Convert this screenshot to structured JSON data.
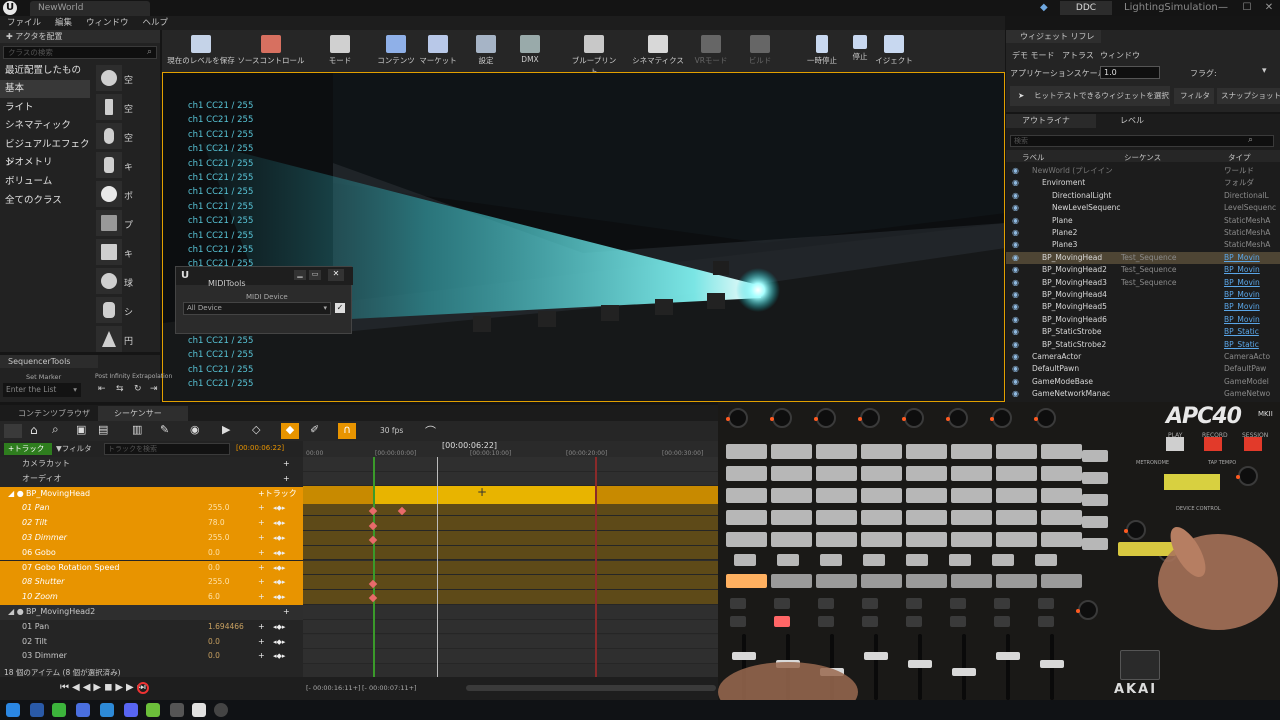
{
  "titlebar": {
    "tab": "NewWorld",
    "ddc": "DDC",
    "project": "LightingSimulation",
    "minimize": "—",
    "maximize": "☐",
    "close": "✕"
  },
  "menu": [
    "ファイル",
    "編集",
    "ウィンドウ",
    "ヘルプ"
  ],
  "place_panel": {
    "header": "アクタを配置",
    "search_placeholder": "クラスの検索",
    "categories": [
      "最近配置したもの",
      "基本",
      "ライト",
      "シネマティック",
      "ビジュアルエフェクト",
      "ジオメトリ",
      "ボリューム",
      "全てのクラス"
    ],
    "actor_labels": [
      "空",
      "空",
      "空",
      "キ",
      "ポ",
      "プ",
      "キ",
      "球",
      "シ",
      "円",
      "平"
    ]
  },
  "toolbar": {
    "buttons": [
      "現在のレベルを保存",
      "ソースコントロール",
      "モード",
      "コンテンツ",
      "マーケット",
      "設定",
      "DMX",
      "ブループリント",
      "シネマティクス",
      "VRモード",
      "ビルド",
      "一時停止",
      "停止",
      "イジェクト"
    ]
  },
  "viewport": {
    "channel_label": "ch1 CC21 / 255",
    "channel_count": 19
  },
  "midi_tools": {
    "title": "MIDITools",
    "device_label": "MIDI Device",
    "device_value": "All Device"
  },
  "sequencer_tools": {
    "title": "SequencerTools",
    "set_marker": "Set Marker",
    "post_infinity": "Post Infinity Extrapolation",
    "list_placeholder": "Enter the List"
  },
  "widget_panel": {
    "tab": "ウィジェット リフレ",
    "menu": [
      "デモ モード",
      "アトラス",
      "ウィンドウ"
    ],
    "app_scale_label": "アプリケーションスケール:",
    "app_scale_value": "1.0",
    "flags_label": "フラグ:",
    "hit_test_label": "ヒットテストできるウィジェットを選択",
    "filter_label": "フィルタ",
    "snapshot_label": "スナップショット"
  },
  "outliner": {
    "tabs": [
      "アウトライナ",
      "レベル"
    ],
    "search_placeholder": "検索",
    "columns": {
      "label": "ラベル",
      "sequence": "シーケンス",
      "type": "タイプ"
    },
    "rows": [
      {
        "name": "NewWorld (プレイイン",
        "seq": "",
        "type": "ワールド",
        "indent": 0,
        "dim": true
      },
      {
        "name": "Enviroment",
        "seq": "",
        "type": "フォルダ",
        "indent": 1
      },
      {
        "name": "DirectionalLight",
        "seq": "",
        "type": "DirectionalL",
        "indent": 2
      },
      {
        "name": "NewLevelSequenc",
        "seq": "",
        "type": "LevelSequenc",
        "indent": 2
      },
      {
        "name": "Plane",
        "seq": "",
        "type": "StaticMeshA",
        "indent": 2
      },
      {
        "name": "Plane2",
        "seq": "",
        "type": "StaticMeshA",
        "indent": 2
      },
      {
        "name": "Plane3",
        "seq": "",
        "type": "StaticMeshA",
        "indent": 2
      },
      {
        "name": "BP_MovingHead",
        "seq": "Test_Sequence",
        "type": "BP_Movin",
        "indent": 1,
        "sel": true,
        "link": true
      },
      {
        "name": "BP_MovingHead2",
        "seq": "Test_Sequence",
        "type": "BP_Movin",
        "indent": 1,
        "link": true
      },
      {
        "name": "BP_MovingHead3",
        "seq": "Test_Sequence",
        "type": "BP_Movin",
        "indent": 1,
        "link": true
      },
      {
        "name": "BP_MovingHead4",
        "seq": "",
        "type": "BP_Movin",
        "indent": 1,
        "link": true
      },
      {
        "name": "BP_MovingHead5",
        "seq": "",
        "type": "BP_Movin",
        "indent": 1,
        "link": true
      },
      {
        "name": "BP_MovingHead6",
        "seq": "",
        "type": "BP_Movin",
        "indent": 1,
        "link": true
      },
      {
        "name": "BP_StaticStrobe",
        "seq": "",
        "type": "BP_Static",
        "indent": 1,
        "link": true
      },
      {
        "name": "BP_StaticStrobe2",
        "seq": "",
        "type": "BP_Static",
        "indent": 1,
        "link": true
      },
      {
        "name": "CameraActor",
        "seq": "",
        "type": "CameraActo",
        "indent": 0
      },
      {
        "name": "DefaultPawn",
        "seq": "",
        "type": "DefaultPaw",
        "indent": 0
      },
      {
        "name": "GameModeBase",
        "seq": "",
        "type": "GameModel",
        "indent": 0
      },
      {
        "name": "GameNetworkManac",
        "seq": "",
        "type": "GameNetwo",
        "indent": 0
      },
      {
        "name": "GameSession",
        "seq": "",
        "type": "GameSessi",
        "indent": 0
      }
    ]
  },
  "sequencer": {
    "tabs": [
      "コンテンツブラウザ",
      "シーケンサー"
    ],
    "fps": "30 fps",
    "current_time": "[00:00:06:22]",
    "track_button": "+トラック",
    "filter_button": "フィルタ",
    "track_search_placeholder": "トラックを検索",
    "time_field": "[00:00:06:22]",
    "ruler": [
      "00:00",
      "[00:00:00:00]",
      "[00:00:10:00]",
      "[00:00:20:00]",
      "[00:00:30:00]"
    ],
    "tracks": [
      {
        "name": "カメラカット",
        "value": "",
        "level": 0,
        "orange": false,
        "italic": false
      },
      {
        "name": "オーディオ",
        "value": "",
        "level": 0,
        "orange": false,
        "italic": false
      },
      {
        "name": "BP_MovingHead",
        "value": "",
        "level": 0,
        "orange": true,
        "italic": false,
        "header": true,
        "add": "トラック"
      },
      {
        "name": "01 Pan",
        "value": "255.0",
        "level": 1,
        "orange": true,
        "italic": true
      },
      {
        "name": "02 Tilt",
        "value": "78.0",
        "level": 1,
        "orange": true,
        "italic": true
      },
      {
        "name": "03 Dimmer",
        "value": "255.0",
        "level": 1,
        "orange": true,
        "italic": true
      },
      {
        "name": "06 Gobo",
        "value": "0.0",
        "level": 1,
        "orange": true,
        "italic": false
      },
      {
        "name": "07 Gobo Rotation Speed",
        "value": "0.0",
        "level": 1,
        "orange": true,
        "italic": false
      },
      {
        "name": "08 Shutter",
        "value": "255.0",
        "level": 1,
        "orange": true,
        "italic": true
      },
      {
        "name": "10 Zoom",
        "value": "6.0",
        "level": 1,
        "orange": true,
        "italic": true
      },
      {
        "name": "BP_MovingHead2",
        "value": "",
        "level": 0,
        "orange": false,
        "italic": false,
        "header": true
      },
      {
        "name": "01 Pan",
        "value": "1.694466",
        "level": 1,
        "orange": false,
        "italic": false
      },
      {
        "name": "02 Tilt",
        "value": "0.0",
        "level": 1,
        "orange": false,
        "italic": false
      },
      {
        "name": "03 Dimmer",
        "value": "0.0",
        "level": 1,
        "orange": false,
        "italic": false
      }
    ],
    "status": "18 個のアイテム (8 個が選択済み)",
    "range_start": "[- 00:00:16:11+]",
    "range_end": "[- 00:00:07:11+]"
  },
  "controller": {
    "brand": "APC40",
    "mk": "MKII",
    "akai": "AKAI",
    "professional": "PROFESSIONAL",
    "labels": [
      "PLAY",
      "RECORD",
      "SESSION",
      "METRONOME",
      "TAP TEMPO",
      "NUDGE",
      "TEMPO",
      "DEVICE CONTROL",
      "MASTER",
      "CUE LEVEL",
      "STOP ALL CLIPS",
      "SCENE LAUNCH",
      "PAN",
      "SENDS",
      "USER",
      "BANK SELECT",
      "SHIFT",
      "CROSSFADER"
    ],
    "track_numbers": [
      "1",
      "2",
      "3",
      "4",
      "5",
      "6",
      "7",
      "8"
    ]
  }
}
